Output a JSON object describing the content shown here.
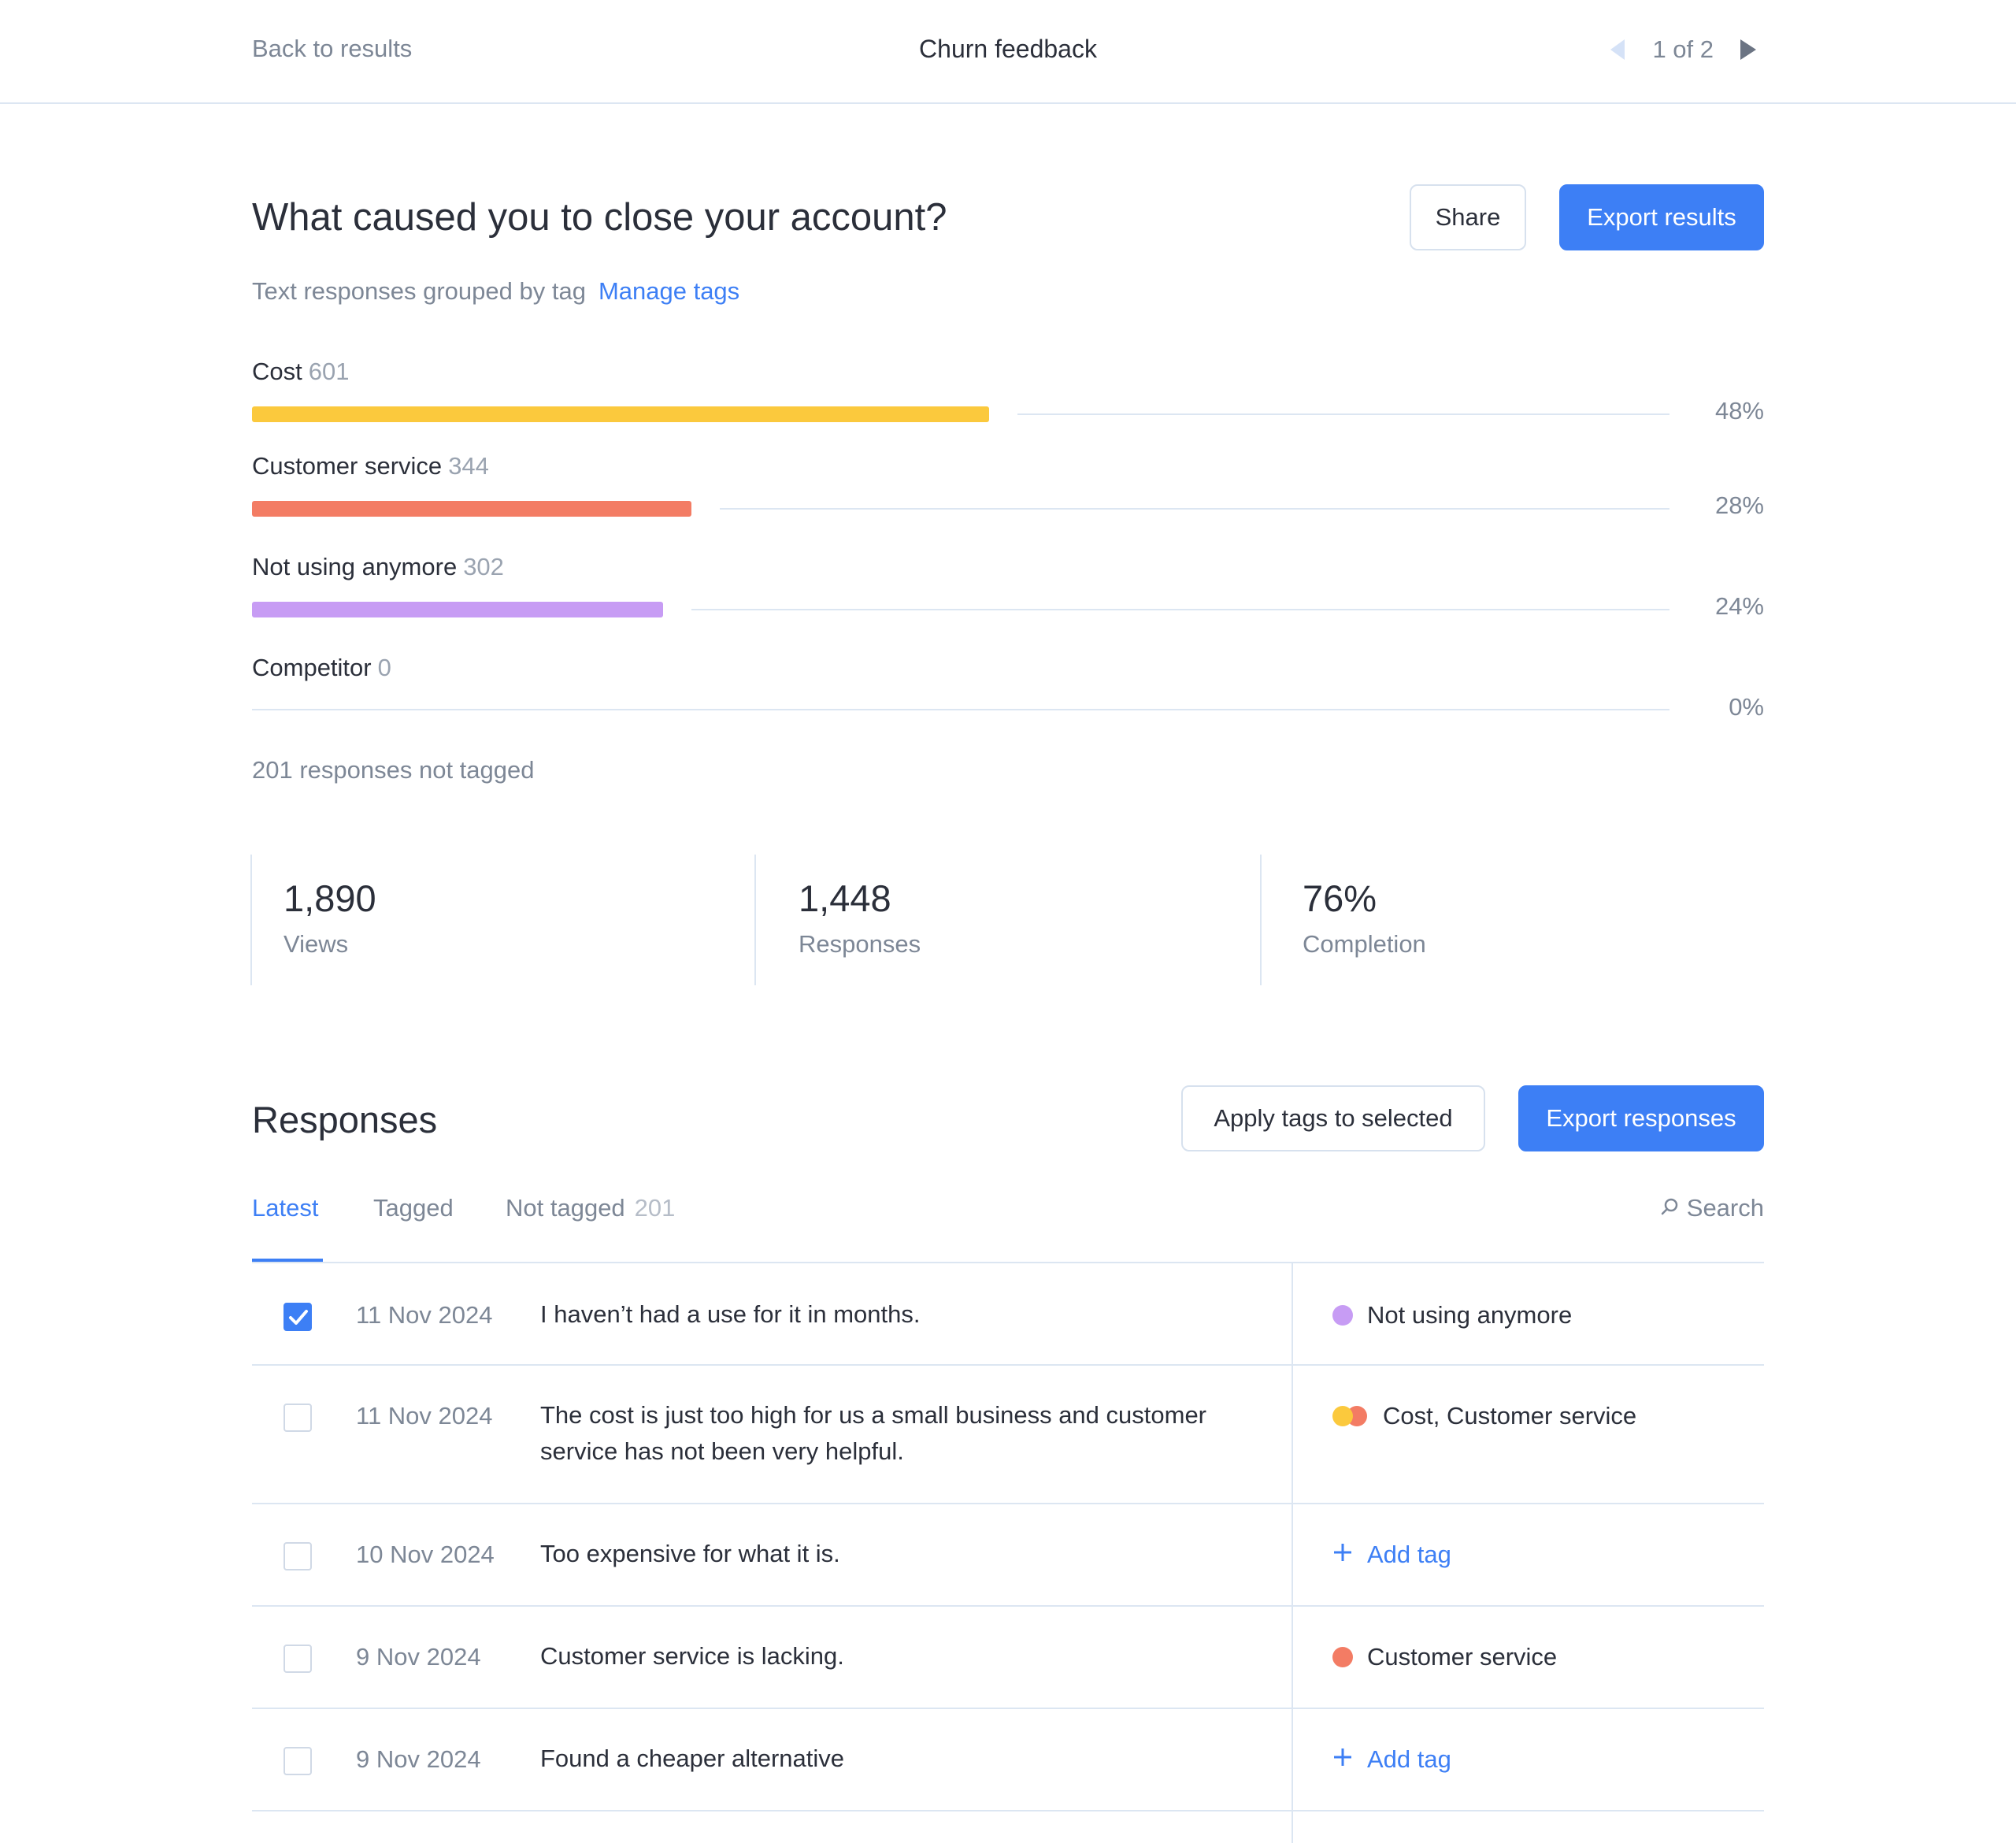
{
  "topbar": {
    "back_label": "Back to results",
    "title": "Churn feedback",
    "pager_text": "1 of 2"
  },
  "question": {
    "title": "What caused you to close your account?",
    "share_label": "Share",
    "export_label": "Export results",
    "subtitle": "Text responses grouped by tag",
    "manage_tags_label": "Manage tags"
  },
  "chart_data": {
    "type": "bar",
    "categories": [
      "Cost",
      "Customer service",
      "Not using anymore",
      "Competitor"
    ],
    "values": [
      601,
      344,
      302,
      0
    ],
    "percent_labels": [
      "48%",
      "28%",
      "24%",
      "0%"
    ],
    "bar_fraction_of_track": [
      0.52,
      0.31,
      0.29,
      0
    ],
    "colors": [
      "#fbc93d",
      "#f37c64",
      "#c79cf4",
      "#c79cf4"
    ]
  },
  "untagged_text": "201 responses not tagged",
  "stats": [
    {
      "value": "1,890",
      "label": "Views"
    },
    {
      "value": "1,448",
      "label": "Responses"
    },
    {
      "value": "76%",
      "label": "Completion"
    }
  ],
  "responses": {
    "title": "Responses",
    "apply_tags_label": "Apply tags to selected",
    "export_label": "Export responses",
    "tabs": [
      {
        "label": "Latest",
        "active": true
      },
      {
        "label": "Tagged"
      },
      {
        "label": "Not tagged",
        "count": "201"
      }
    ],
    "search_label": "Search",
    "rows": [
      {
        "date": "11 Nov 2024",
        "text": "I haven’t had a use for it in months.",
        "tag": "Not using anymore",
        "checked": true
      },
      {
        "date": "11 Nov 2024",
        "text": "The cost is just too high for us a small business and customer service has not been very helpful.",
        "tag": "Cost, Customer service",
        "checked": false
      },
      {
        "date": "10 Nov 2024",
        "text": "Too expensive for what it is.",
        "tag": "Add tag",
        "checked": false
      },
      {
        "date": "9 Nov 2024",
        "text": "Customer service is lacking.",
        "tag": "Customer service",
        "checked": false
      },
      {
        "date": "9 Nov 2024",
        "text": "Found a cheaper alternative",
        "tag": "Add tag",
        "checked": false
      }
    ]
  },
  "colors": {
    "accent": "#3d7ff5",
    "cost": "#fbc93d",
    "customer_service": "#f37c64",
    "not_using": "#c79cf4"
  }
}
